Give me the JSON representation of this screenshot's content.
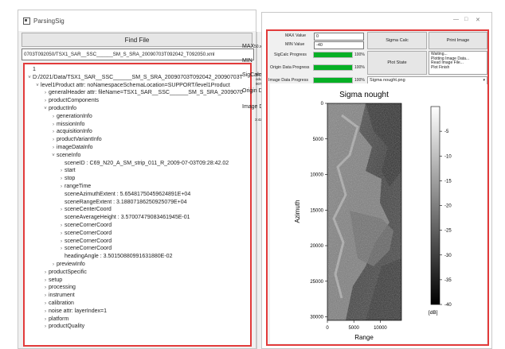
{
  "left_window": {
    "title": "ParsingSig",
    "find_button": "Find File",
    "path_value": "0703T092050/TSX1_SAR__SSC______SM_S_SRA_20090703T092042_T092050.xml",
    "tree": [
      {
        "level": 0,
        "arrow": "",
        "text": "1"
      },
      {
        "level": 0,
        "arrow": "v",
        "text": "D:/2021/Data/TSX1_SAR__SSC______SM_S_SRA_20090703T092042_20090703T"
      },
      {
        "level": 1,
        "arrow": "v",
        "text": "level1Product attr: noNamespaceSchemaLocation=SUPPORT/level1Product"
      },
      {
        "level": 2,
        "arrow": ">",
        "text": "generalHeader attr: fileName=TSX1_SAR__SSC______SM_S_SRA_2009070"
      },
      {
        "level": 2,
        "arrow": ">",
        "text": "productComponents"
      },
      {
        "level": 2,
        "arrow": "v",
        "text": "productInfo"
      },
      {
        "level": 3,
        "arrow": ">",
        "text": "generationInfo"
      },
      {
        "level": 3,
        "arrow": ">",
        "text": "missionInfo"
      },
      {
        "level": 3,
        "arrow": ">",
        "text": "acquisitionInfo"
      },
      {
        "level": 3,
        "arrow": ">",
        "text": "productVariantInfo"
      },
      {
        "level": 3,
        "arrow": ">",
        "text": "imageDataInfo"
      },
      {
        "level": 3,
        "arrow": "v",
        "text": "sceneInfo"
      },
      {
        "level": 4,
        "arrow": "",
        "text": "sceneID : C69_N20_A_SM_strip_011_R_2009-07-03T09:28:42.02"
      },
      {
        "level": 4,
        "arrow": ">",
        "text": "start"
      },
      {
        "level": 4,
        "arrow": ">",
        "text": "stop"
      },
      {
        "level": 4,
        "arrow": ">",
        "text": "rangeTime"
      },
      {
        "level": 4,
        "arrow": "",
        "text": "sceneAzimuthExtent : 5.65481750459624891E+04"
      },
      {
        "level": 4,
        "arrow": "",
        "text": "sceneRangeExtent : 3.18807186250925079E+04"
      },
      {
        "level": 4,
        "arrow": ">",
        "text": "sceneCenterCoord"
      },
      {
        "level": 4,
        "arrow": "",
        "text": "sceneAverageHeight : 3.57007479083461945E-01"
      },
      {
        "level": 4,
        "arrow": ">",
        "text": "sceneCornerCoord"
      },
      {
        "level": 4,
        "arrow": ">",
        "text": "sceneCornerCoord"
      },
      {
        "level": 4,
        "arrow": ">",
        "text": "sceneCornerCoord"
      },
      {
        "level": 4,
        "arrow": ">",
        "text": "sceneCornerCoord"
      },
      {
        "level": 4,
        "arrow": "",
        "text": "headingAngle : 3.50150880991631880E-02"
      },
      {
        "level": 3,
        "arrow": ">",
        "text": "previewInfo"
      },
      {
        "level": 2,
        "arrow": ">",
        "text": "productSpecific"
      },
      {
        "level": 2,
        "arrow": ">",
        "text": "setup"
      },
      {
        "level": 2,
        "arrow": ">",
        "text": "processing"
      },
      {
        "level": 2,
        "arrow": ">",
        "text": "instrument"
      },
      {
        "level": 2,
        "arrow": ">",
        "text": "calibration"
      },
      {
        "level": 2,
        "arrow": ">",
        "text": "noise attr: layerIndex=1"
      },
      {
        "level": 2,
        "arrow": ">",
        "text": "platform"
      },
      {
        "level": 2,
        "arrow": ">",
        "text": "productQuality"
      }
    ]
  },
  "middle_window": {
    "labels": [
      "MAX",
      "MIN",
      "SigCalc",
      "Origin Da",
      "Image Da"
    ],
    "snippets": [
      "50.xml",
      "90703",
      "oduct",
      "90703",
      "3:42.02"
    ]
  },
  "right_window": {
    "title_controls": [
      "—",
      "□",
      "✕"
    ],
    "max_label": "MAX Value",
    "max_value": "0",
    "min_label": "MIN Value",
    "min_value": "-40",
    "sigma_calc_button": "Sigma Calc",
    "print_image_button": "Print Image",
    "sigcalc_label": "SigCalc Progress",
    "origin_label": "Origin Data Progress",
    "image_label": "Image Data Progress",
    "progress": [
      1.0,
      1.0,
      1.0
    ],
    "pct_labels": [
      "100%",
      "100%",
      "100%"
    ],
    "plot_state_label": "Plot State",
    "log_lines": [
      "Waiting...",
      "Plotting Image Data...",
      "Read Image File...",
      "Plot Finish"
    ],
    "combo_value": "Sigma nought.png",
    "combo_arrow": "▾"
  },
  "chart_data": {
    "type": "heatmap",
    "title": "Sigma nought",
    "xlabel": "Range",
    "ylabel": "Azimuth",
    "x_ticks": [
      "0",
      "5000",
      "10000"
    ],
    "y_ticks": [
      "0",
      "5000",
      "10000",
      "15000",
      "20000",
      "25000",
      "30000"
    ],
    "xlim": [
      0,
      14000
    ],
    "ylim": [
      0,
      30500
    ],
    "colorbar_ticks": [
      "-5",
      "-10",
      "-15",
      "-20",
      "-25",
      "-30",
      "-35",
      "-40"
    ],
    "colorbar_unit": "[dB]",
    "colormap": "gray",
    "vmin": -40,
    "vmax": 0
  },
  "colors": {
    "highlight_border": "#e23b3b",
    "progress_green": "#06b025"
  }
}
